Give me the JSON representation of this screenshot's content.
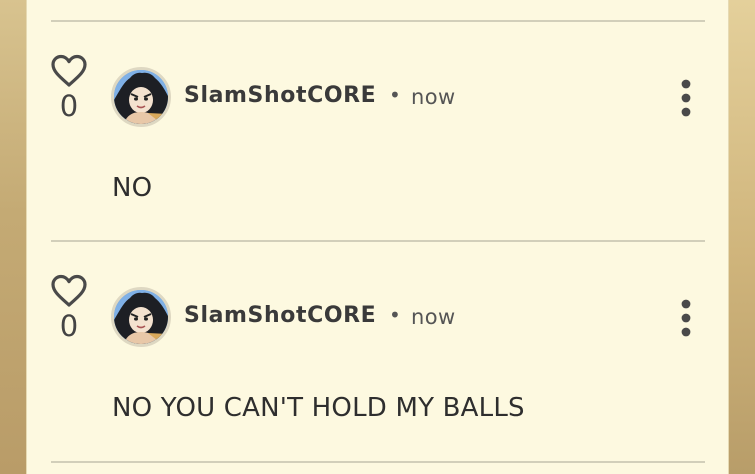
{
  "comments": [
    {
      "votes": "0",
      "author": "SlamShotCORE",
      "separator": "•",
      "time": "now",
      "text": "NO"
    },
    {
      "votes": "0",
      "author": "SlamShotCORE",
      "separator": "•",
      "time": "now",
      "text": "NO YOU CAN'T HOLD MY BALLS"
    }
  ],
  "icons": {
    "like": "heart-icon",
    "menu": "more-vertical-icon"
  },
  "colors": {
    "panel_background": "#fdf9e0",
    "divider": "#d2cfba",
    "text": "#3a3a3a",
    "page_background": "#c9b27c"
  }
}
